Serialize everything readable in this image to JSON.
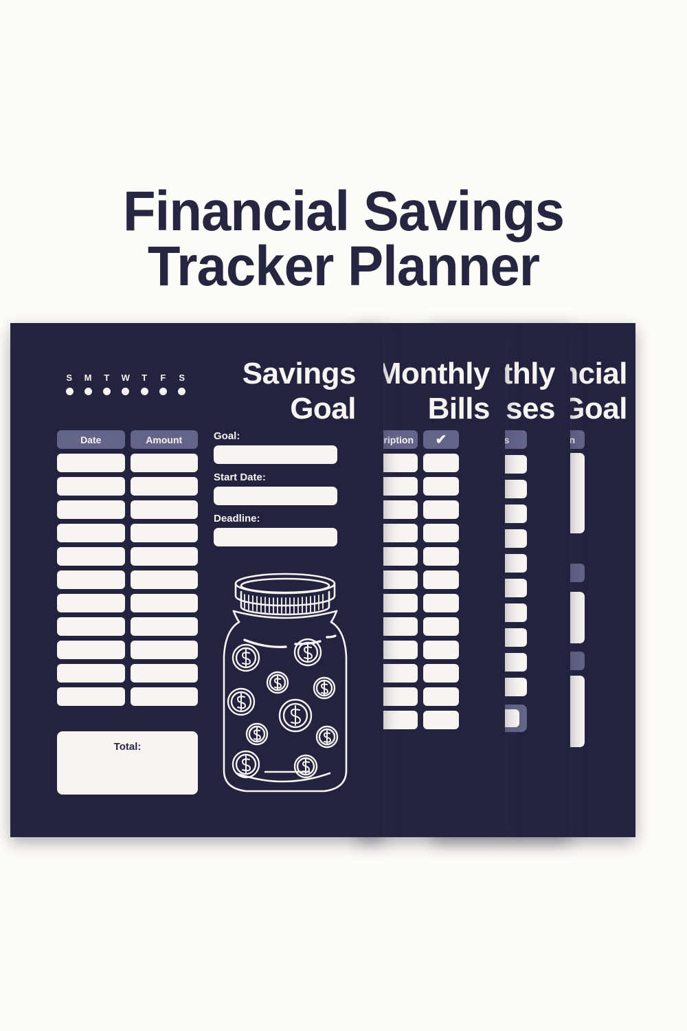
{
  "page": {
    "background_color": "#FEFCF8",
    "accent_navy": "#232340",
    "accent_purple": "#63648A",
    "paper_white": "#F7F4F2"
  },
  "title": {
    "line1": "Financial Savings",
    "line2": "Tracker Planner"
  },
  "cards": {
    "main": {
      "heading_line1": "Savings",
      "heading_line2": "Goal",
      "weekdays": [
        "S",
        "M",
        "T",
        "W",
        "T",
        "F",
        "S"
      ],
      "table_headers": [
        "Date",
        "Amount"
      ],
      "row_count": 11,
      "total_label": "Total:",
      "form_fields": [
        {
          "label": "Goal:",
          "value": ""
        },
        {
          "label": "Start Date:",
          "value": ""
        },
        {
          "label": "Deadline:",
          "value": ""
        }
      ],
      "illustration": "money-jar-with-coins"
    },
    "monthly_bills": {
      "heading_line1": "Monthly",
      "heading_line2": "Bills",
      "headers": [
        "Description",
        "✔"
      ],
      "row_count": 12
    },
    "monthly_expenses": {
      "heading_line1": "Monthly",
      "heading_line2": "Expenses",
      "headers": [
        "Expenses"
      ],
      "row_count": 10,
      "has_total_row": true
    },
    "financial_goal": {
      "heading_line1": "Financial",
      "heading_line2": "Goal",
      "headers": [
        "Motivation"
      ],
      "sections": 3
    }
  }
}
